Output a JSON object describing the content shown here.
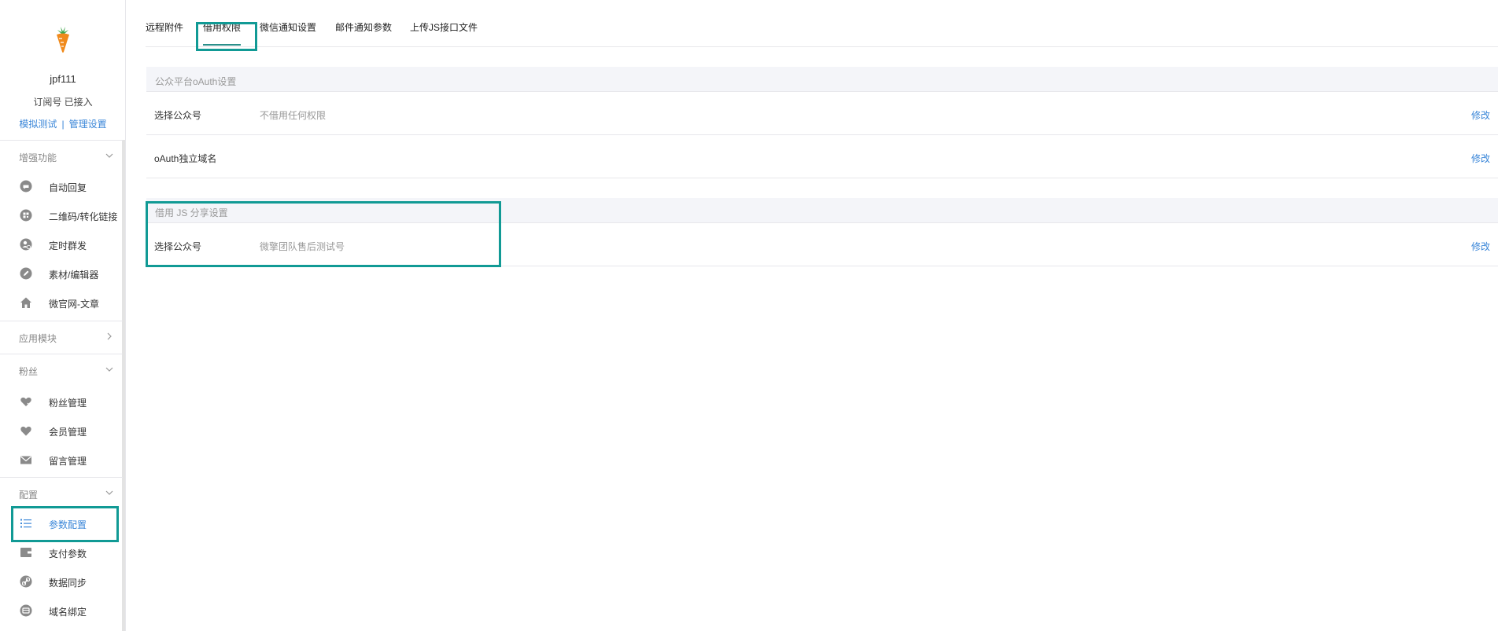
{
  "account": {
    "name": "jpf111",
    "subtitle": "订阅号 已接入",
    "link_test": "模拟测试",
    "link_separator": "|",
    "link_manage": "管理设置"
  },
  "sidebar": {
    "groups": [
      {
        "label": "增强功能",
        "items": [
          {
            "label": "自动回复",
            "icon": "chat-bubble-icon"
          },
          {
            "label": "二维码/转化链接",
            "icon": "qrcode-icon"
          },
          {
            "label": "定时群发",
            "icon": "clock-user-icon"
          },
          {
            "label": "素材/编辑器",
            "icon": "pencil-icon"
          },
          {
            "label": "微官网-文章",
            "icon": "home-icon"
          }
        ]
      },
      {
        "label": "应用模块",
        "items": []
      },
      {
        "label": "粉丝",
        "items": [
          {
            "label": "粉丝管理",
            "icon": "heart-check-icon"
          },
          {
            "label": "会员管理",
            "icon": "heart-icon"
          },
          {
            "label": "留言管理",
            "icon": "mail-icon"
          }
        ]
      },
      {
        "label": "配置",
        "items": [
          {
            "label": "参数配置",
            "icon": "list-icon"
          },
          {
            "label": "支付参数",
            "icon": "wallet-icon"
          },
          {
            "label": "数据同步",
            "icon": "link-icon"
          },
          {
            "label": "域名绑定",
            "icon": "globe-icon"
          }
        ]
      }
    ]
  },
  "tabs": [
    {
      "label": "远程附件"
    },
    {
      "label": "借用权限"
    },
    {
      "label": "微信通知设置"
    },
    {
      "label": "邮件通知参数"
    },
    {
      "label": "上传JS接口文件"
    }
  ],
  "sections": [
    {
      "title": "公众平台oAuth设置",
      "rows": [
        {
          "key": "选择公众号",
          "value": "不借用任何权限",
          "action": "修改"
        },
        {
          "key": "oAuth独立域名",
          "value": "",
          "action": "修改"
        }
      ]
    },
    {
      "title": "借用 JS 分享设置",
      "rows": [
        {
          "key": "选择公众号",
          "value": "微擎团队售后测试号",
          "action": "修改"
        }
      ]
    }
  ],
  "colors": {
    "accent": "#3a86d8",
    "highlight": "#119a95",
    "icon_gray": "#8a8a8a",
    "active_icon": "#3a86d8"
  }
}
